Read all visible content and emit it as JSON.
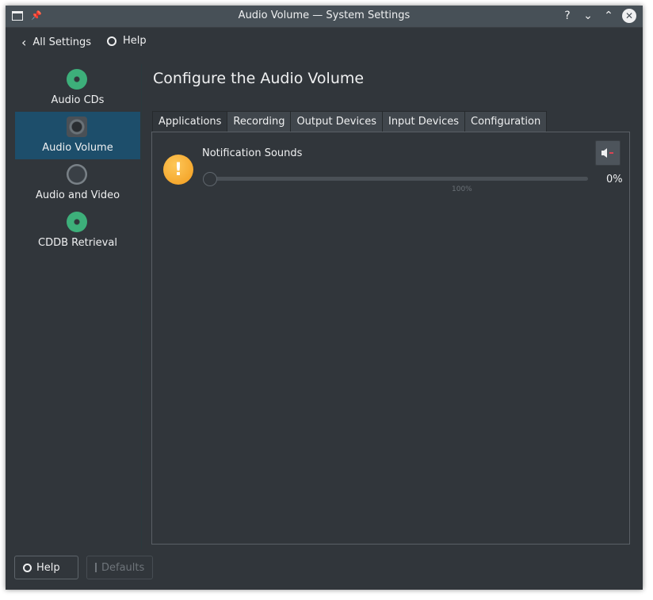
{
  "window": {
    "title": "Audio Volume — System Settings"
  },
  "titlebar_buttons": [
    "?",
    "⌄",
    "⌃",
    "✕"
  ],
  "toolbar": {
    "back_label": "All Settings",
    "help_label": "Help"
  },
  "sidebar": {
    "items": [
      {
        "label": "Audio CDs",
        "icon": "audio-cd-icon",
        "active": false
      },
      {
        "label": "Audio Volume",
        "icon": "speaker-icon",
        "active": true
      },
      {
        "label": "Audio and Video",
        "icon": "knob-icon",
        "active": false
      },
      {
        "label": "CDDB Retrieval",
        "icon": "audio-cd-icon",
        "active": false
      }
    ]
  },
  "main": {
    "title": "Configure the Audio Volume",
    "tabs": [
      {
        "label": "Applications",
        "active": true
      },
      {
        "label": "Recording",
        "active": false
      },
      {
        "label": "Output Devices",
        "active": false
      },
      {
        "label": "Input Devices",
        "active": false
      },
      {
        "label": "Configuration",
        "active": false
      }
    ],
    "stream": {
      "name": "Notification Sounds",
      "icon_glyph": "!",
      "volume_percent": 0,
      "volume_label": "0%",
      "tick_label": "100%",
      "muted": true
    }
  },
  "bottom": {
    "help_label": "Help",
    "defaults_label": "Defaults"
  },
  "colors": {
    "window_bg": "#31363b",
    "titlebar": "#475057",
    "selection": "#1d4e6b",
    "accent_green": "#3daf7a",
    "warning_orange": "#f6a623"
  }
}
